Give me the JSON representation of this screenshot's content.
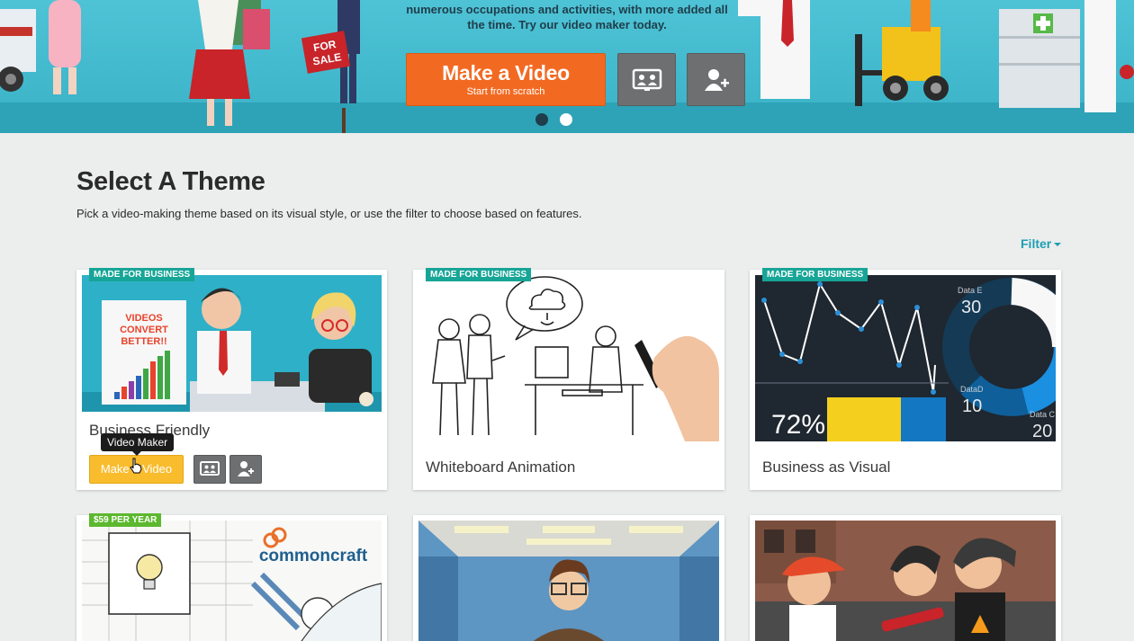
{
  "hero": {
    "tagline": "numerous occupations and activities, with more added all the time. Try our video maker today.",
    "sign_text": "FOR SALE",
    "make_video_label": "Make a Video",
    "make_video_sub": "Start from scratch",
    "icons": [
      "presentation-icon",
      "add-user-icon"
    ],
    "slides": 2,
    "active_slide": 1
  },
  "section": {
    "title": "Select A Theme",
    "subtitle": "Pick a video-making theme based on its visual style, or use the filter to choose based on features.",
    "filter_label": "Filter"
  },
  "cards": [
    {
      "name": "Business Friendly",
      "badge": "MADE FOR BUSINESS",
      "badge_color": "#17a597",
      "thumb_text": "VIDEOS CONVERT BETTER!!",
      "hovered": true,
      "make_label": "Make a Video",
      "tooltip": "Video Maker"
    },
    {
      "name": "Whiteboard Animation",
      "badge": "MADE FOR BUSINESS",
      "badge_color": "#17a597"
    },
    {
      "name": "Business as Visual",
      "badge": "MADE FOR BUSINESS",
      "badge_color": "#17a597",
      "thumb_text": {
        "big": "72%",
        "data_e_label": "Data E",
        "data_e_value": "30",
        "data_d_label": "DataD",
        "data_d_value": "10",
        "data_c_label": "Data C",
        "data_c_value": "20"
      }
    },
    {
      "name": "",
      "badge": "$59 PER YEAR",
      "badge_color": "#5cb82e",
      "thumb_text": "commoncraft"
    },
    {
      "name": ""
    },
    {
      "name": ""
    }
  ],
  "colors": {
    "accent_orange": "#f26a22",
    "accent_yellow": "#f9bc2d",
    "link_teal": "#1e9fb3",
    "icon_button_gray": "#6d6f71"
  }
}
